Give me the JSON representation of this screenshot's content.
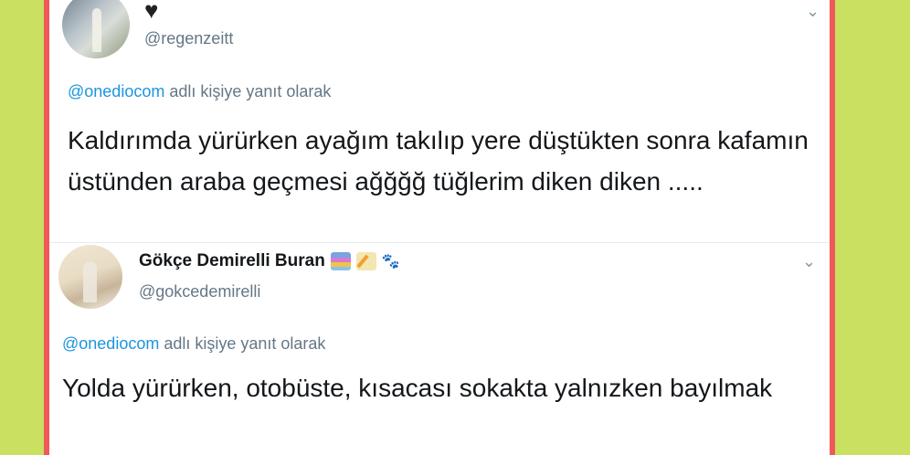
{
  "tweets": [
    {
      "name": "",
      "handle": "@regenzeitt",
      "reply_mention": "@onediocom",
      "reply_suffix": " adlı kişiye yanıt olarak",
      "text": "Kaldırımda yürürken ayağım takılıp yere düştükten sonra kafamın üstünden araba geçmesi ağğğğ tüğlerim diken diken .....",
      "badge": "♥"
    },
    {
      "name": "Gökçe Demirelli Buran",
      "handle": "@gokcedemirelli",
      "reply_mention": "@onediocom",
      "reply_suffix": " adlı kişiye yanıt olarak",
      "text": "Yolda yürürken, otobüste, kısacası sokakta yalnızken bayılmak",
      "emojis": [
        "books-emoji",
        "memo-emoji",
        "paw-prints-emoji"
      ],
      "paws": "🐾"
    }
  ],
  "chevron": "⌄",
  "colors": {
    "background": "#c9e060",
    "frame": "#f0585a",
    "link": "#1b95e0",
    "muted": "#657786",
    "text": "#14171a"
  }
}
